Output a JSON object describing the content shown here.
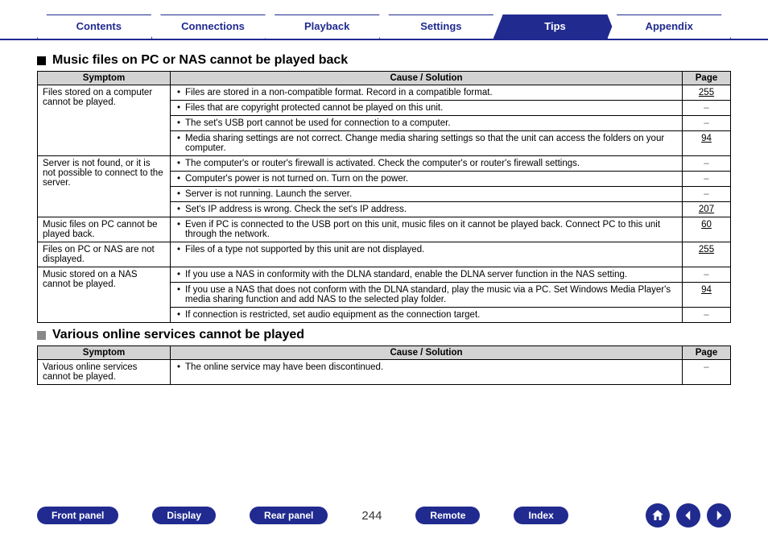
{
  "tabs": [
    {
      "label": "Contents",
      "active": false
    },
    {
      "label": "Connections",
      "active": false
    },
    {
      "label": "Playback",
      "active": false
    },
    {
      "label": "Settings",
      "active": false
    },
    {
      "label": "Tips",
      "active": true
    },
    {
      "label": "Appendix",
      "active": false
    }
  ],
  "sections": [
    {
      "heading": "Music files on PC or NAS cannot be played back",
      "headingStyle": "black",
      "headers": {
        "symptom": "Symptom",
        "cause": "Cause / Solution",
        "page": "Page"
      },
      "groups": [
        {
          "symptom": "Files stored on a computer cannot be played.",
          "rows": [
            {
              "cause": "Files are stored in a non-compatible format. Record in a compatible format.",
              "page": "255",
              "link": true
            },
            {
              "cause": "Files that are copyright protected cannot be played on this unit.",
              "page": "–",
              "link": false
            },
            {
              "cause": "The set's USB port cannot be used for connection to a computer.",
              "page": "–",
              "link": false
            },
            {
              "cause": "Media sharing settings are not correct. Change media sharing settings so that the unit can access the folders on your computer.",
              "page": "94",
              "link": true
            }
          ]
        },
        {
          "symptom": "Server is not found, or it is not possible to connect to the server.",
          "rows": [
            {
              "cause": "The computer's or router's firewall is activated. Check the computer's or router's firewall settings.",
              "page": "–",
              "link": false
            },
            {
              "cause": "Computer's power is not turned on. Turn on the power.",
              "page": "–",
              "link": false
            },
            {
              "cause": "Server is not running. Launch the server.",
              "page": "–",
              "link": false
            },
            {
              "cause": "Set's IP address is wrong. Check the set's IP address.",
              "page": "207",
              "link": true
            }
          ]
        },
        {
          "symptom": "Music files on PC cannot be played back.",
          "rows": [
            {
              "cause": "Even if PC is connected to the USB port on this unit, music files on it cannot be played back. Connect PC to this unit through the network.",
              "page": "60",
              "link": true
            }
          ]
        },
        {
          "symptom": "Files on PC or NAS are not displayed.",
          "rows": [
            {
              "cause": "Files of a type not supported by this unit are not displayed.",
              "page": "255",
              "link": true
            }
          ]
        },
        {
          "symptom": "Music stored on a NAS cannot be played.",
          "rows": [
            {
              "cause": "If you use a NAS in conformity with the DLNA standard, enable the DLNA server function in the NAS setting.",
              "page": "–",
              "link": false
            },
            {
              "cause": "If you use a NAS that does not conform with the DLNA standard, play the music via a PC. Set Windows Media Player's media sharing function and add NAS to the selected play folder.",
              "page": "94",
              "link": true
            },
            {
              "cause": "If connection is restricted, set audio equipment as the connection target.",
              "page": "–",
              "link": false
            }
          ]
        }
      ]
    },
    {
      "heading": "Various online services cannot be played",
      "headingStyle": "grey",
      "headers": {
        "symptom": "Symptom",
        "cause": "Cause / Solution",
        "page": "Page"
      },
      "groups": [
        {
          "symptom": "Various online services cannot be played.",
          "rows": [
            {
              "cause": "The online service may have been discontinued.",
              "page": "–",
              "link": false
            }
          ]
        }
      ]
    }
  ],
  "bottom": {
    "pills": [
      "Front panel",
      "Display",
      "Rear panel"
    ],
    "pills2": [
      "Remote",
      "Index"
    ],
    "page": "244"
  }
}
